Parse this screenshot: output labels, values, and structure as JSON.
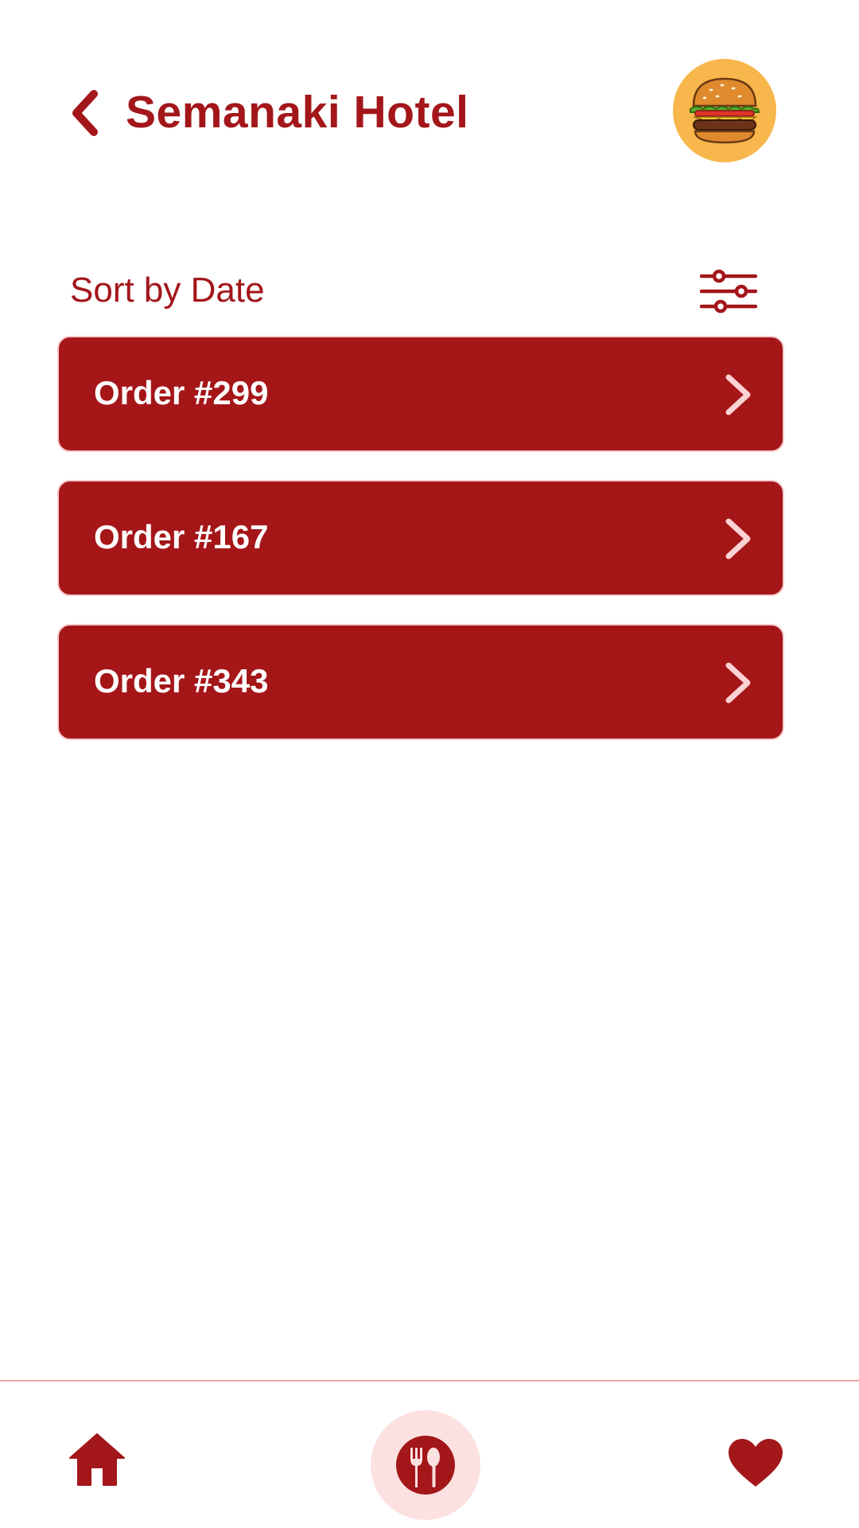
{
  "header": {
    "title": "Semanaki Hotel",
    "back_icon": "chevron-left-icon",
    "avatar_icon": "burger-icon"
  },
  "sort": {
    "label": "Sort by Date",
    "filter_icon": "sliders-icon"
  },
  "orders": [
    {
      "label": "Order #299"
    },
    {
      "label": "Order #167"
    },
    {
      "label": "Order #343"
    }
  ],
  "bottom_nav": {
    "items": [
      {
        "icon": "home-icon"
      },
      {
        "icon": "fork-spoon-icon",
        "active": true
      },
      {
        "icon": "heart-icon"
      }
    ]
  },
  "colors": {
    "brand": "#a3161a",
    "card": "#a51619",
    "avatar_bg": "#f8b74c",
    "nav_active_bg": "#fde1e1",
    "divider": "#f2a3a5"
  }
}
